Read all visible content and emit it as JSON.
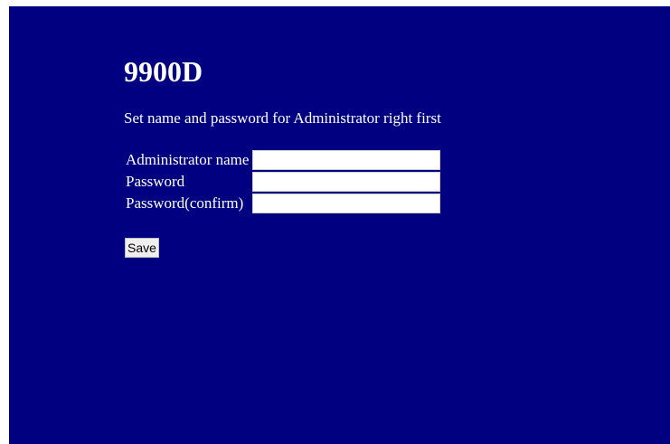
{
  "page": {
    "title": "9900D",
    "subtitle": "Set name and password for Administrator right first"
  },
  "form": {
    "fields": [
      {
        "label": "Administrator name",
        "value": "",
        "placeholder": ""
      },
      {
        "label": "Password",
        "value": "",
        "placeholder": ""
      },
      {
        "label": "Password(confirm)",
        "value": "",
        "placeholder": ""
      }
    ],
    "save_label": "Save"
  },
  "colors": {
    "background": "#000080",
    "text": "#ffffff",
    "input_background": "#ffffff"
  }
}
